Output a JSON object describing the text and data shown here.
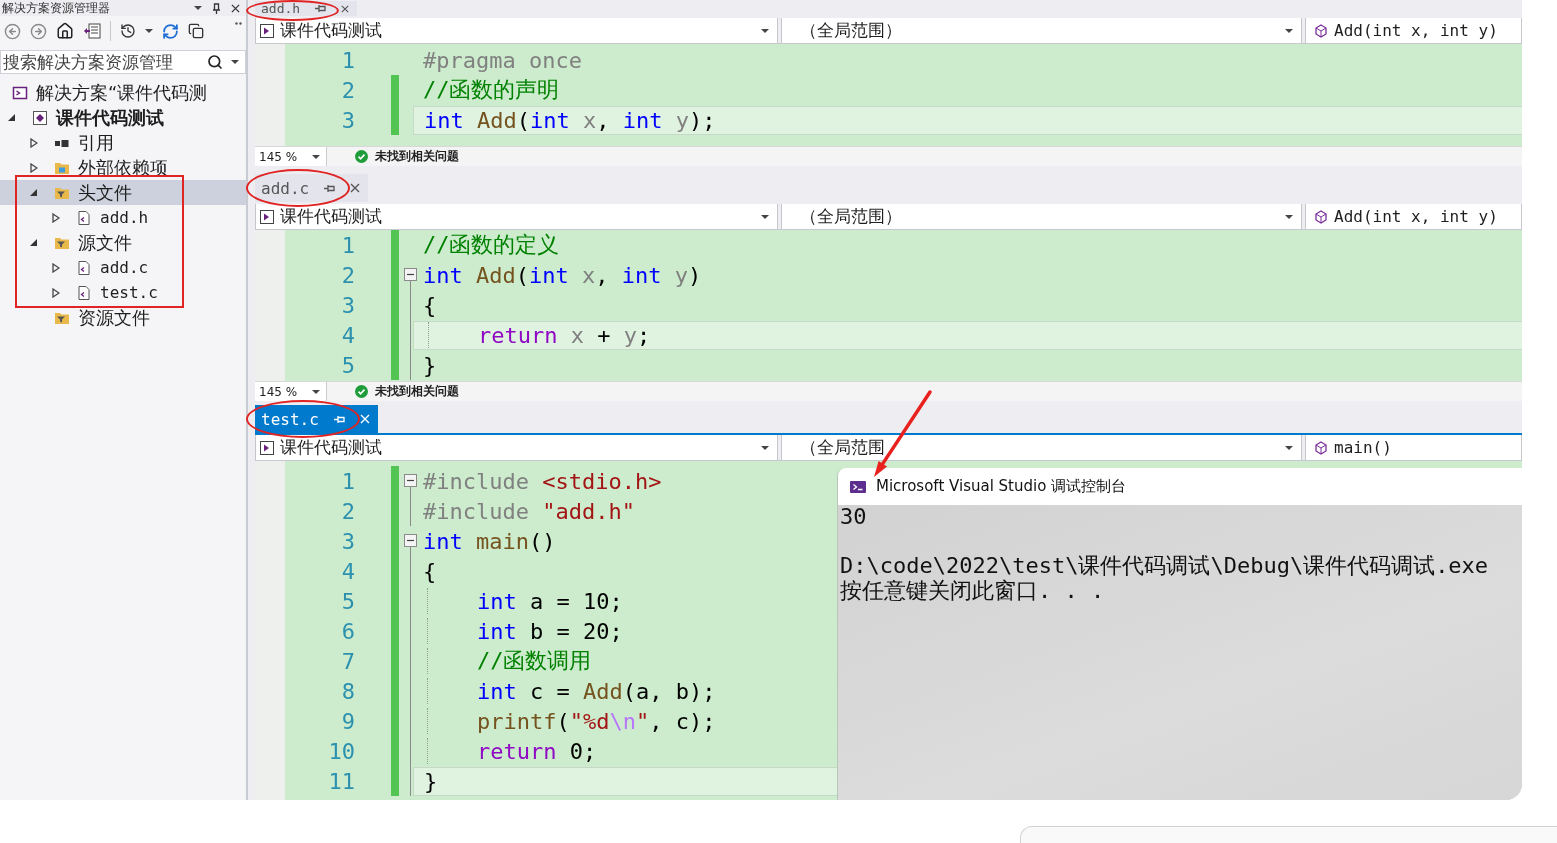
{
  "explorer": {
    "title": "解决方案资源管理器",
    "search": {
      "placeholder": "搜索解决方案资源管理"
    },
    "tree": [
      {
        "label": "解决方案“课件代码测",
        "kind": "solution",
        "selected": false,
        "children": [
          {
            "label": "课件代码测试",
            "kind": "project",
            "selected": false,
            "expanded": true,
            "children": [
              {
                "label": "引用",
                "kind": "references",
                "selected": false,
                "expanded": false
              },
              {
                "label": "外部依赖项",
                "kind": "external",
                "selected": false,
                "expanded": false
              },
              {
                "label": "头文件",
                "kind": "filter",
                "selected": true,
                "expanded": true,
                "children": [
                  {
                    "label": "add.h",
                    "kind": "file",
                    "selected": false,
                    "expanded": false
                  }
                ]
              },
              {
                "label": "源文件",
                "kind": "filter",
                "selected": false,
                "expanded": true,
                "children": [
                  {
                    "label": "add.c",
                    "kind": "file",
                    "selected": false,
                    "expanded": false
                  },
                  {
                    "label": "test.c",
                    "kind": "file",
                    "selected": false,
                    "expanded": false
                  }
                ]
              },
              {
                "label": "资源文件",
                "kind": "filter",
                "selected": false
              }
            ]
          }
        ]
      }
    ]
  },
  "editors": [
    {
      "tab": {
        "label": "add.h",
        "selected": false
      },
      "nav": {
        "project": "课件代码测试",
        "scope": "（全局范围）",
        "member": "Add(int x, int y)"
      },
      "lines": [
        {
          "number": "1",
          "changed": false,
          "current": false,
          "indented": false,
          "collapsible": false,
          "in_block": false,
          "tokens": [
            {
              "text": "#pragma once",
              "kind": "preprocessor"
            }
          ]
        },
        {
          "number": "2",
          "changed": true,
          "current": false,
          "indented": false,
          "collapsible": false,
          "in_block": false,
          "tokens": [
            {
              "text": "//函数的声明",
              "kind": "comment"
            }
          ]
        },
        {
          "number": "3",
          "changed": true,
          "current": true,
          "indented": false,
          "collapsible": false,
          "in_block": false,
          "tokens": [
            {
              "text": "int ",
              "kind": "keyword"
            },
            {
              "text": "Add",
              "kind": "function"
            },
            {
              "text": "(",
              "kind": "plain"
            },
            {
              "text": "int ",
              "kind": "keyword"
            },
            {
              "text": "x",
              "kind": "param"
            },
            {
              "text": ", ",
              "kind": "plain"
            },
            {
              "text": "int ",
              "kind": "keyword"
            },
            {
              "text": "y",
              "kind": "param"
            },
            {
              "text": ");",
              "kind": "plain"
            }
          ]
        }
      ],
      "status": {
        "zoom": "145 %",
        "message": "未找到相关问题"
      }
    },
    {
      "tab": {
        "label": "add.c",
        "selected": false
      },
      "nav": {
        "project": "课件代码测试",
        "scope": "（全局范围）",
        "member": "Add(int x, int y)"
      },
      "lines": [
        {
          "number": "1",
          "changed": true,
          "current": false,
          "indented": false,
          "collapsible": false,
          "in_block": false,
          "tokens": [
            {
              "text": "//函数的定义",
              "kind": "comment"
            }
          ]
        },
        {
          "number": "2",
          "changed": true,
          "current": false,
          "indented": false,
          "collapsible": true,
          "in_block": false,
          "tokens": [
            {
              "text": "int ",
              "kind": "keyword"
            },
            {
              "text": "Add",
              "kind": "function"
            },
            {
              "text": "(",
              "kind": "plain"
            },
            {
              "text": "int ",
              "kind": "keyword"
            },
            {
              "text": "x",
              "kind": "param"
            },
            {
              "text": ", ",
              "kind": "plain"
            },
            {
              "text": "int ",
              "kind": "keyword"
            },
            {
              "text": "y",
              "kind": "param"
            },
            {
              "text": ")",
              "kind": "plain"
            }
          ]
        },
        {
          "number": "3",
          "changed": true,
          "current": false,
          "indented": false,
          "collapsible": false,
          "in_block": true,
          "tokens": [
            {
              "text": "{",
              "kind": "plain"
            }
          ]
        },
        {
          "number": "4",
          "changed": true,
          "current": true,
          "indented": true,
          "collapsible": false,
          "in_block": true,
          "tokens": [
            {
              "text": "return ",
              "kind": "control"
            },
            {
              "text": "x",
              "kind": "param"
            },
            {
              "text": " + ",
              "kind": "plain"
            },
            {
              "text": "y",
              "kind": "param"
            },
            {
              "text": ";",
              "kind": "plain"
            }
          ]
        },
        {
          "number": "5",
          "changed": true,
          "current": false,
          "indented": false,
          "collapsible": false,
          "in_block": true,
          "tokens": [
            {
              "text": "}",
              "kind": "plain"
            }
          ]
        }
      ],
      "status": {
        "zoom": "145 %",
        "message": "未找到相关问题"
      }
    },
    {
      "tab": {
        "label": "test.c",
        "selected": true
      },
      "nav": {
        "project": "课件代码测试",
        "scope": "（全局范围",
        "member": "main()"
      },
      "lines": [
        {
          "number": "1",
          "changed": true,
          "current": false,
          "indented": false,
          "collapsible": true,
          "in_block": false,
          "tokens": [
            {
              "text": "#include ",
              "kind": "preprocessor"
            },
            {
              "text": "<stdio.h>",
              "kind": "string"
            }
          ]
        },
        {
          "number": "2",
          "changed": true,
          "current": false,
          "indented": false,
          "collapsible": false,
          "in_block": true,
          "tokens": [
            {
              "text": "#include ",
              "kind": "preprocessor"
            },
            {
              "text": "\"add.h\"",
              "kind": "string"
            }
          ]
        },
        {
          "number": "3",
          "changed": true,
          "current": false,
          "indented": false,
          "collapsible": true,
          "in_block": false,
          "tokens": [
            {
              "text": "int ",
              "kind": "keyword"
            },
            {
              "text": "main",
              "kind": "function"
            },
            {
              "text": "()",
              "kind": "plain"
            }
          ]
        },
        {
          "number": "4",
          "changed": true,
          "current": false,
          "indented": false,
          "collapsible": false,
          "in_block": true,
          "tokens": [
            {
              "text": "{",
              "kind": "plain"
            }
          ]
        },
        {
          "number": "5",
          "changed": true,
          "current": false,
          "indented": true,
          "collapsible": false,
          "in_block": true,
          "tokens": [
            {
              "text": "int ",
              "kind": "keyword"
            },
            {
              "text": "a = 10;",
              "kind": "plain"
            }
          ]
        },
        {
          "number": "6",
          "changed": true,
          "current": false,
          "indented": true,
          "collapsible": false,
          "in_block": true,
          "tokens": [
            {
              "text": "int ",
              "kind": "keyword"
            },
            {
              "text": "b = 20;",
              "kind": "plain"
            }
          ]
        },
        {
          "number": "7",
          "changed": true,
          "current": false,
          "indented": true,
          "collapsible": false,
          "in_block": true,
          "tokens": [
            {
              "text": "//函数调用",
              "kind": "comment"
            }
          ]
        },
        {
          "number": "8",
          "changed": true,
          "current": false,
          "indented": true,
          "collapsible": false,
          "in_block": true,
          "tokens": [
            {
              "text": "int ",
              "kind": "keyword"
            },
            {
              "text": "c = ",
              "kind": "plain"
            },
            {
              "text": "Add",
              "kind": "function"
            },
            {
              "text": "(a, b);",
              "kind": "plain"
            }
          ]
        },
        {
          "number": "9",
          "changed": true,
          "current": false,
          "indented": true,
          "collapsible": false,
          "in_block": true,
          "tokens": [
            {
              "text": "printf",
              "kind": "function"
            },
            {
              "text": "(",
              "kind": "plain"
            },
            {
              "text": "\"%d",
              "kind": "string"
            },
            {
              "text": "\\n",
              "kind": "escape"
            },
            {
              "text": "\"",
              "kind": "string"
            },
            {
              "text": ", c);",
              "kind": "plain"
            }
          ]
        },
        {
          "number": "10",
          "changed": true,
          "current": false,
          "indented": true,
          "collapsible": false,
          "in_block": true,
          "tokens": [
            {
              "text": "return ",
              "kind": "control"
            },
            {
              "text": "0;",
              "kind": "plain"
            }
          ]
        },
        {
          "number": "11",
          "changed": true,
          "current": true,
          "indented": false,
          "collapsible": false,
          "in_block": true,
          "tokens": [
            {
              "text": "}",
              "kind": "plain"
            }
          ]
        }
      ]
    }
  ],
  "console": {
    "title": "Microsoft Visual Studio 调试控制台",
    "output": [
      [
        "30"
      ],
      [
        "D:\\code\\2022\\test\\课件代码调试\\Debug\\课件代码调试.exe",
        "按任意键关闭此窗口. . ."
      ]
    ]
  }
}
